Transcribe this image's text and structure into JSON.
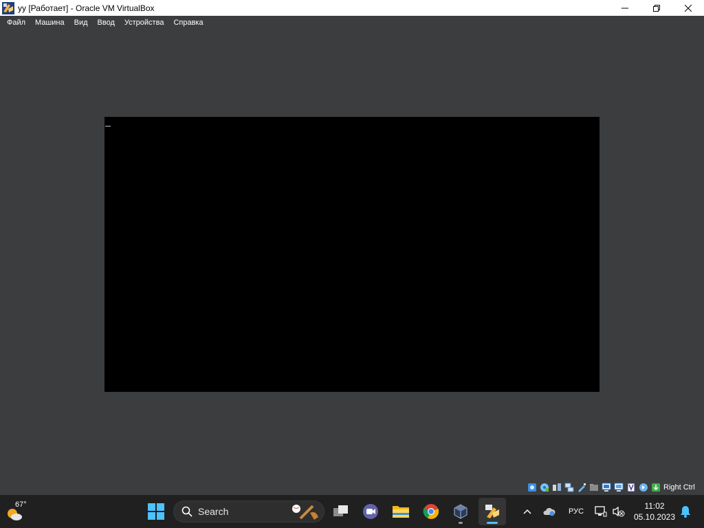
{
  "window": {
    "title": "yy [Работает] - Oracle VM VirtualBox",
    "controls": [
      "minimize",
      "maximize",
      "close"
    ]
  },
  "menu": {
    "items": [
      "Файл",
      "Машина",
      "Вид",
      "Ввод",
      "Устройства",
      "Справка"
    ]
  },
  "vm": {
    "screen_color": "#000000"
  },
  "statusbar": {
    "icons": [
      "hard-disk-icon",
      "optical-drive-icon",
      "audio-icon",
      "network-icon",
      "usb-icon",
      "shared-folders-icon",
      "display-icon",
      "recording-icon",
      "virtualization-icon",
      "mouse-integration-icon",
      "keyboard-icon"
    ],
    "host_key": "Right Ctrl"
  },
  "taskbar": {
    "weather_temp": "67°",
    "search_placeholder": "Search",
    "apps": [
      "start",
      "search",
      "task-view",
      "teams",
      "file-explorer",
      "chrome",
      "virtualbox",
      "virtualbox-vm"
    ],
    "language": "РУС",
    "time": "11:02",
    "date": "05.10.2023"
  },
  "colors": {
    "background": "#3c3d3f",
    "taskbar": "#202020",
    "accent": "#4cc2ff"
  }
}
